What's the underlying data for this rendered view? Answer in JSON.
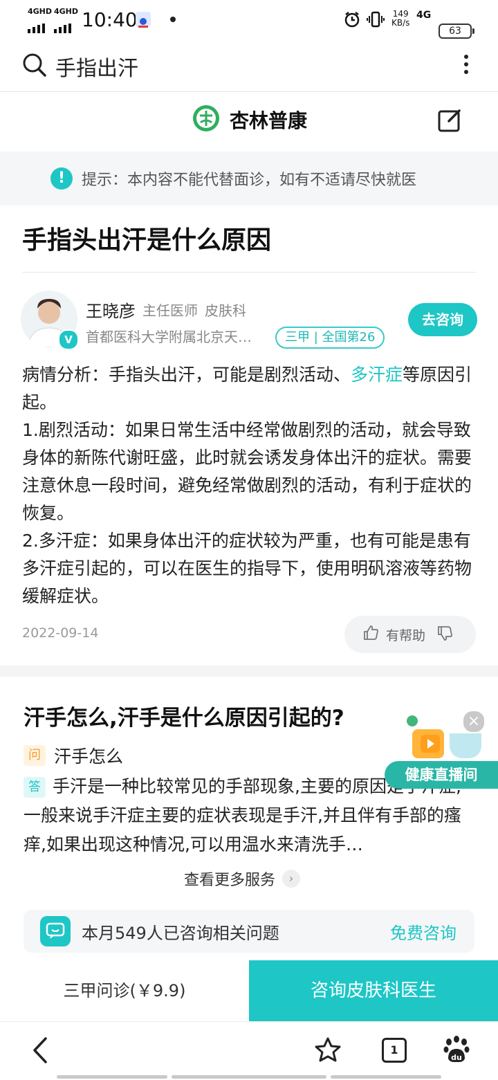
{
  "status_bar": {
    "network_1": "4GHD",
    "network_2": "4GHD",
    "time": "10:40",
    "speed_value": "149",
    "speed_unit": "KB/s",
    "network_type": "4G",
    "battery": "63"
  },
  "search": {
    "query": "手指出汗"
  },
  "header": {
    "brand": "杏林普康"
  },
  "notice": {
    "text": "提示：本内容不能代替面诊，如有不适请尽快就医"
  },
  "article": {
    "title": "手指头出汗是什么原因",
    "doctor": {
      "name": "王晓彦",
      "title": "主任医师",
      "department": "皮肤科",
      "hospital": "首都医科大学附属北京天…",
      "badge": "三甲 | 全国第26",
      "verified_mark": "V",
      "consult_button": "去咨询"
    },
    "analysis": {
      "p1_before": "病情分析：手指头出汗，可能是剧烈活动、",
      "p1_link": "多汗症",
      "p1_after": "等原因引起。",
      "p2": "1.剧烈活动：如果日常生活中经常做剧烈的活动，就会导致身体的新陈代谢旺盛，此时就会诱发身体出汗的症状。需要注意休息一段时间，避免经常做剧烈的活动，有利于症状的恢复。",
      "p3": "2.多汗症：如果身体出汗的症状较为严重，也有可能是患有多汗症引起的，可以在医生的指导下，使用明矾溶液等药物缓解症状。"
    },
    "date": "2022-09-14",
    "helpful_label": "有帮助"
  },
  "qa": {
    "title": "汗手怎么,汗手是什么原因引起的?",
    "q_tag": "问",
    "question": "汗手怎么",
    "a_tag": "答",
    "answer": "手汗是一种比较常见的手部现象,主要的原因是手汗症,一般来说手汗症主要的症状表现是手汗,并且伴有手部的瘙痒,如果出现这种情况,可以用温水来清洗手…",
    "more_services": "查看更多服务"
  },
  "consult_strip": {
    "text": "本月549人已咨询相关问题",
    "link": "免费咨询"
  },
  "live_widget": {
    "label": "健康直播间"
  },
  "bottom_actions": {
    "left": "三甲问诊(￥9.9)",
    "right": "咨询皮肤科医生"
  },
  "nav": {
    "tab_count": "1"
  },
  "colors": {
    "accent": "#1ec6c6",
    "warning": "#f0a030"
  }
}
